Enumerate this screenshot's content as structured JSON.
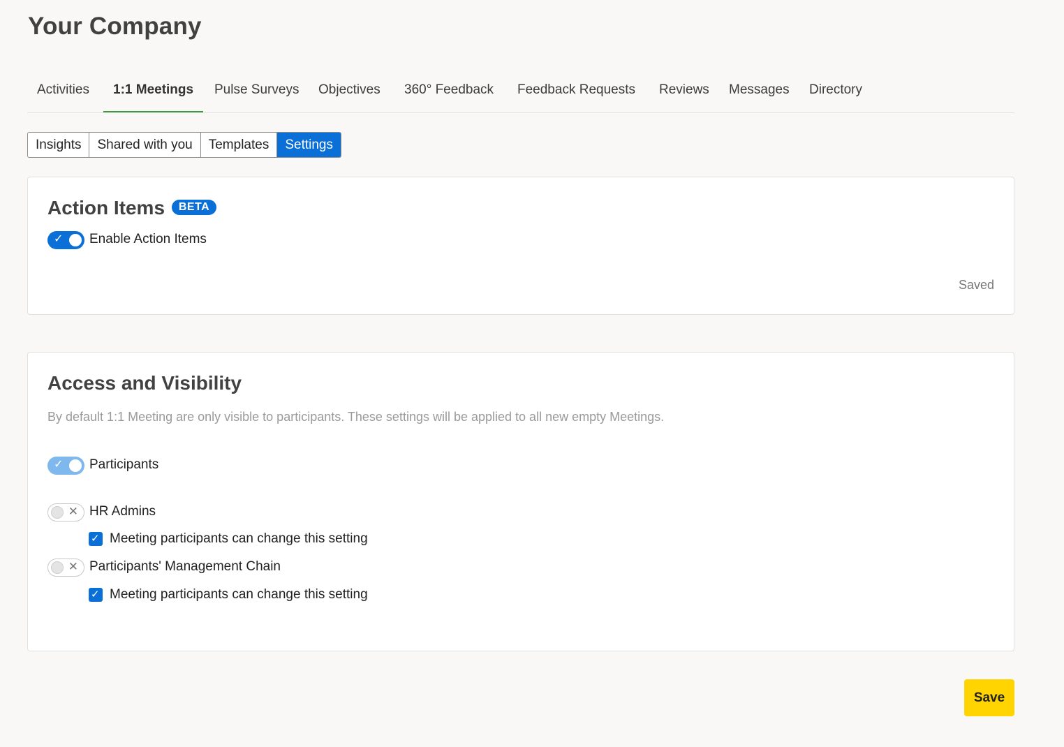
{
  "company": {
    "title": "Your Company"
  },
  "main_tabs": [
    {
      "label": "Activities"
    },
    {
      "label": "1:1 Meetings",
      "active": true
    },
    {
      "label": "Pulse Surveys"
    },
    {
      "label": "Objectives"
    },
    {
      "label": "360° Feedback"
    },
    {
      "label": "Feedback Requests"
    },
    {
      "label": "Reviews"
    },
    {
      "label": "Messages"
    },
    {
      "label": "Directory"
    }
  ],
  "sub_tabs": [
    {
      "label": "Insights"
    },
    {
      "label": "Shared with you"
    },
    {
      "label": "Templates"
    },
    {
      "label": "Settings",
      "active": true
    }
  ],
  "action_items": {
    "title": "Action Items",
    "badge": "BETA",
    "toggle_label": "Enable Action Items",
    "toggle_state": "on",
    "status": "Saved"
  },
  "access_visibility": {
    "title": "Access and Visibility",
    "description": "By default 1:1 Meeting are only visible to participants. These settings will be applied to all new empty Meetings.",
    "participants": {
      "label": "Participants",
      "state": "on",
      "disabled": true
    },
    "hr_admins": {
      "label": "HR Admins",
      "state": "off",
      "checkbox_label": "Meeting participants can change this setting",
      "checked": true
    },
    "management_chain": {
      "label": "Participants' Management Chain",
      "state": "off",
      "checkbox_label": "Meeting participants can change this setting",
      "checked": true
    }
  },
  "footer": {
    "save_label": "Save"
  },
  "icons": {
    "check": "✓",
    "cross": "✕"
  },
  "colors": {
    "primary": "#0a6fd6",
    "tab_underline": "#3c9a3c",
    "save": "#ffd400"
  }
}
